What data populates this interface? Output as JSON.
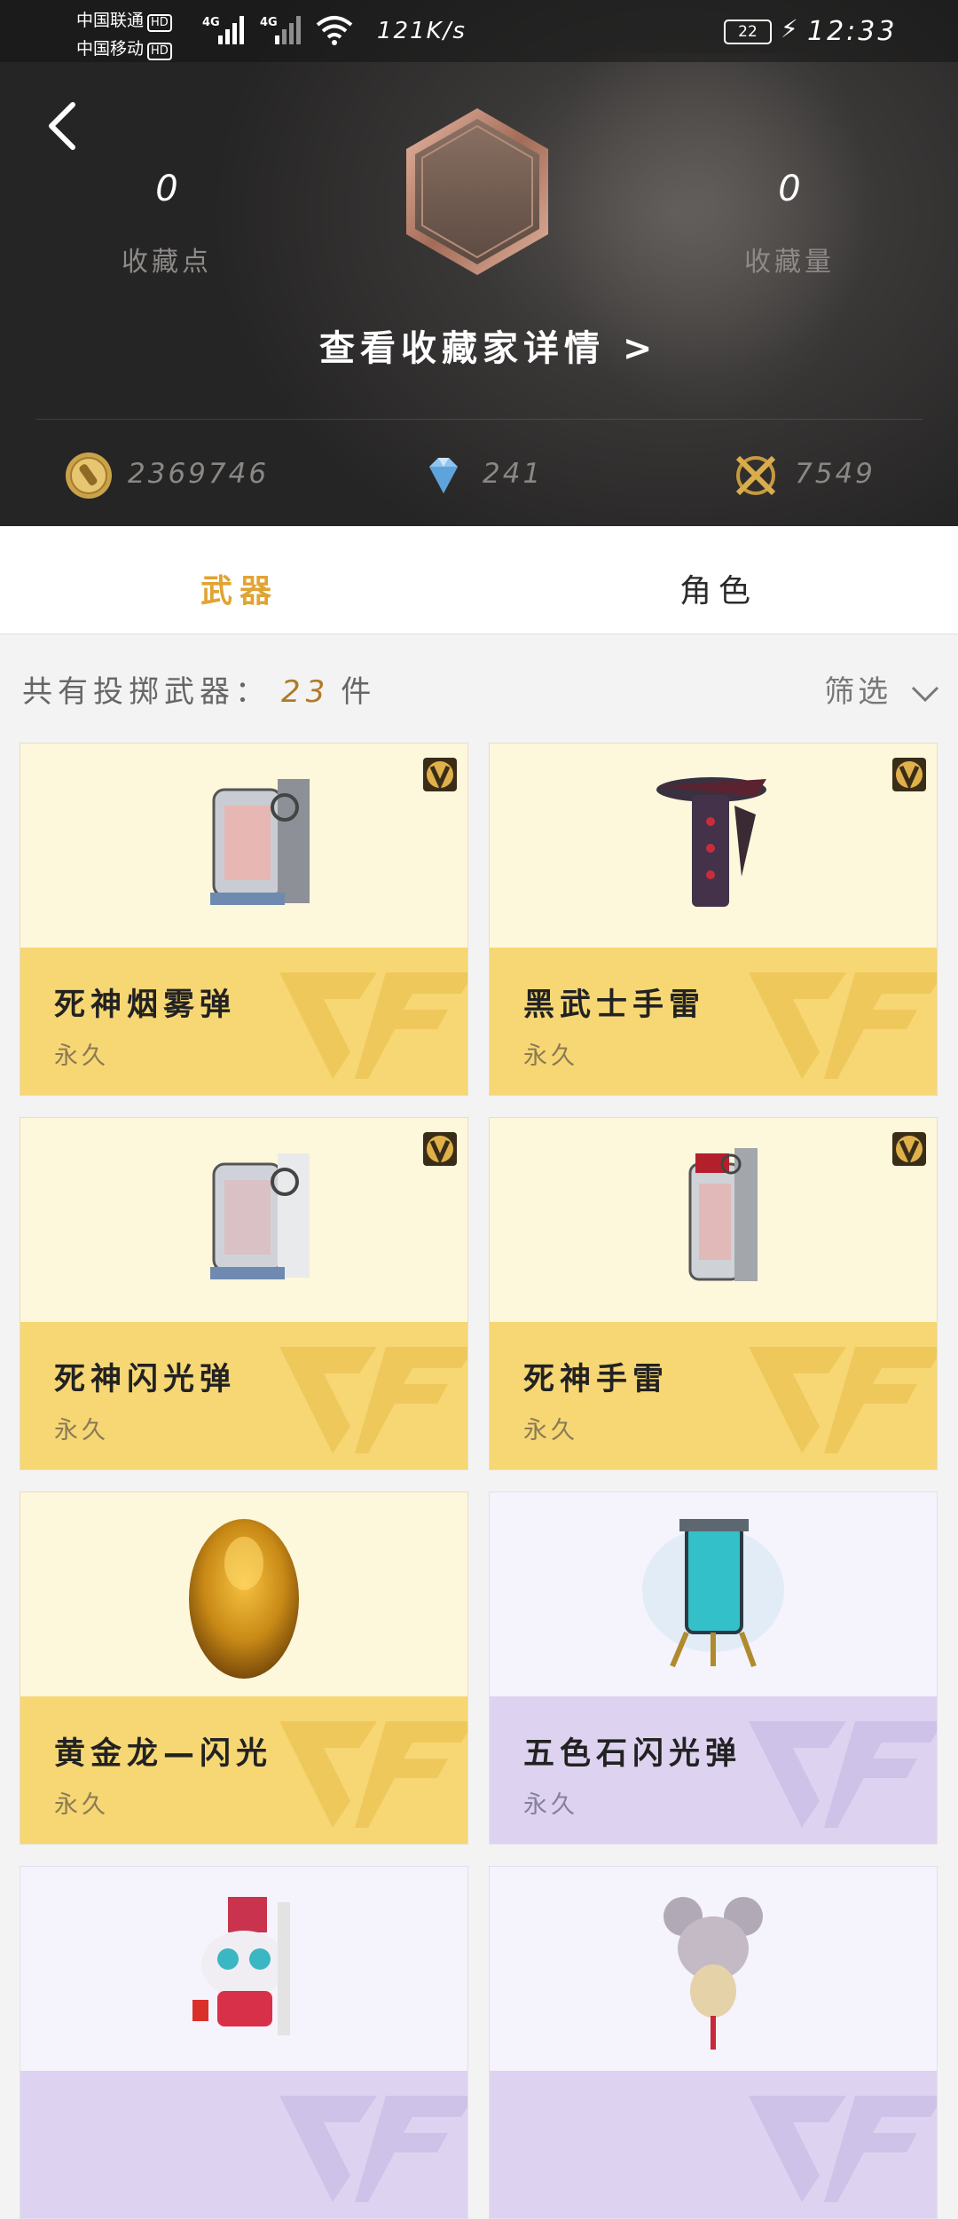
{
  "status_bar": {
    "carrier1": "中国联通",
    "carrier2": "中国移动",
    "hd": "HD",
    "net1": "4G",
    "net2": "4G",
    "speed": "121K/s",
    "battery": "22",
    "time": "12:33"
  },
  "header": {
    "collection_points_value": "0",
    "collection_points_label": "收藏点",
    "collection_count_value": "0",
    "collection_count_label": "收藏量",
    "details_link": "查看收藏家详情 >",
    "currencies": [
      {
        "icon": "gold-coin-icon",
        "amount": "2369746"
      },
      {
        "icon": "diamond-icon",
        "amount": "241"
      },
      {
        "icon": "crossed-guns-icon",
        "amount": "7549"
      }
    ]
  },
  "tabs": [
    {
      "label": "武器",
      "active": true
    },
    {
      "label": "角色",
      "active": false
    }
  ],
  "summary": {
    "prefix": "共有投掷武器：",
    "count": "23",
    "suffix": "件",
    "filter_label": "筛选"
  },
  "items": [
    {
      "name": "死神烟雾弹",
      "duration": "永久",
      "theme": "gold",
      "vip": true,
      "art": "reaper-smoke-grenade"
    },
    {
      "name": "黑武士手雷",
      "duration": "永久",
      "theme": "gold",
      "vip": true,
      "art": "dark-knight-grenade"
    },
    {
      "name": "死神闪光弹",
      "duration": "永久",
      "theme": "gold",
      "vip": true,
      "art": "reaper-flash-grenade"
    },
    {
      "name": "死神手雷",
      "duration": "永久",
      "theme": "gold",
      "vip": true,
      "art": "reaper-grenade"
    },
    {
      "name": "黄金龙—闪光",
      "duration": "永久",
      "theme": "gold",
      "vip": false,
      "art": "golden-dragon-egg"
    },
    {
      "name": "五色石闪光弹",
      "duration": "永久",
      "theme": "purple",
      "vip": false,
      "art": "five-color-stone-grenade"
    },
    {
      "name": "",
      "duration": "",
      "theme": "purple",
      "vip": false,
      "art": "lion-dance-grenade"
    },
    {
      "name": "",
      "duration": "",
      "theme": "purple",
      "vip": false,
      "art": "mouse-mascot-grenade"
    }
  ],
  "colors": {
    "accent": "#e0a433",
    "card_gold_top": "#fdf7dc",
    "card_gold_bottom": "#f6d774",
    "card_purple_top": "#f5f3fb",
    "card_purple_bottom": "#ddd3f0"
  }
}
